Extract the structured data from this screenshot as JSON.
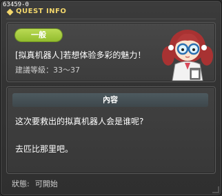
{
  "window": {
    "quest_id": "63459-0",
    "title": "QUEST INFO"
  },
  "quest": {
    "category_badge": "一般",
    "name": "[拟真机器人]若想体验多彩的魅力！",
    "level_label": "建議等級：",
    "level_range": "33～37"
  },
  "content": {
    "header": "內容",
    "lines": [
      "这次要救出的拟真机器人会是谁呢?",
      "去匹比那里吧。"
    ]
  },
  "status": {
    "label": "狀態:",
    "value": "可開始"
  },
  "colors": {
    "title_accent": "#f2d66b",
    "badge_green": "#a6cc3f",
    "panel_bg": "#444444"
  },
  "icons": {
    "npc_avatar": "scientist-girl-with-glasses"
  }
}
